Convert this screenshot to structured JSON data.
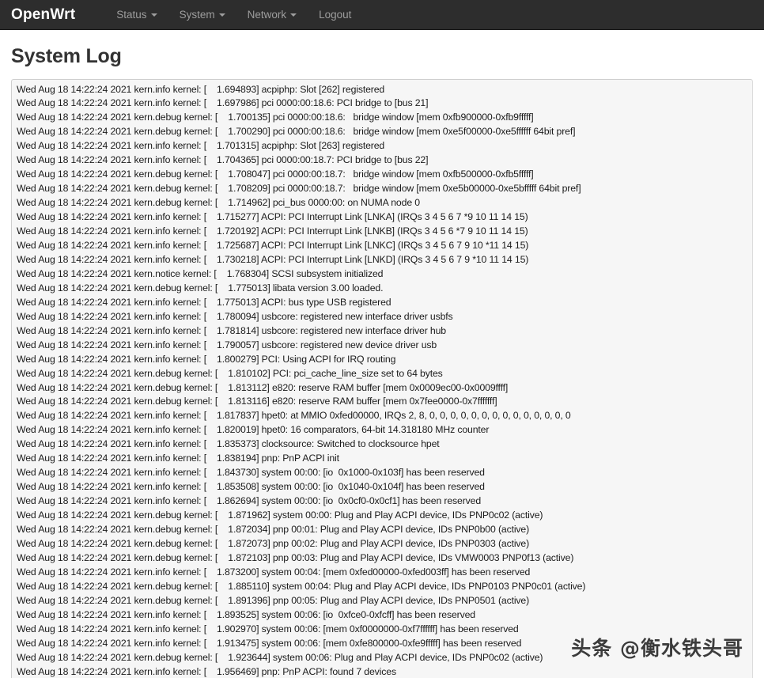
{
  "navbar": {
    "brand": "OpenWrt",
    "items": [
      {
        "label": "Status",
        "has_caret": true
      },
      {
        "label": "System",
        "has_caret": true
      },
      {
        "label": "Network",
        "has_caret": true
      },
      {
        "label": "Logout",
        "has_caret": false
      }
    ]
  },
  "page": {
    "title": "System Log"
  },
  "log": {
    "lines": [
      "Wed Aug 18 14:22:24 2021 kern.info kernel: [    1.694893] acpiphp: Slot [262] registered",
      "Wed Aug 18 14:22:24 2021 kern.info kernel: [    1.697986] pci 0000:00:18.6: PCI bridge to [bus 21]",
      "Wed Aug 18 14:22:24 2021 kern.debug kernel: [    1.700135] pci 0000:00:18.6:   bridge window [mem 0xfb900000-0xfb9fffff]",
      "Wed Aug 18 14:22:24 2021 kern.debug kernel: [    1.700290] pci 0000:00:18.6:   bridge window [mem 0xe5f00000-0xe5ffffff 64bit pref]",
      "Wed Aug 18 14:22:24 2021 kern.info kernel: [    1.701315] acpiphp: Slot [263] registered",
      "Wed Aug 18 14:22:24 2021 kern.info kernel: [    1.704365] pci 0000:00:18.7: PCI bridge to [bus 22]",
      "Wed Aug 18 14:22:24 2021 kern.debug kernel: [    1.708047] pci 0000:00:18.7:   bridge window [mem 0xfb500000-0xfb5fffff]",
      "Wed Aug 18 14:22:24 2021 kern.debug kernel: [    1.708209] pci 0000:00:18.7:   bridge window [mem 0xe5b00000-0xe5bfffff 64bit pref]",
      "Wed Aug 18 14:22:24 2021 kern.debug kernel: [    1.714962] pci_bus 0000:00: on NUMA node 0",
      "Wed Aug 18 14:22:24 2021 kern.info kernel: [    1.715277] ACPI: PCI Interrupt Link [LNKA] (IRQs 3 4 5 6 7 *9 10 11 14 15)",
      "Wed Aug 18 14:22:24 2021 kern.info kernel: [    1.720192] ACPI: PCI Interrupt Link [LNKB] (IRQs 3 4 5 6 *7 9 10 11 14 15)",
      "Wed Aug 18 14:22:24 2021 kern.info kernel: [    1.725687] ACPI: PCI Interrupt Link [LNKC] (IRQs 3 4 5 6 7 9 10 *11 14 15)",
      "Wed Aug 18 14:22:24 2021 kern.info kernel: [    1.730218] ACPI: PCI Interrupt Link [LNKD] (IRQs 3 4 5 6 7 9 *10 11 14 15)",
      "Wed Aug 18 14:22:24 2021 kern.notice kernel: [    1.768304] SCSI subsystem initialized",
      "Wed Aug 18 14:22:24 2021 kern.debug kernel: [    1.775013] libata version 3.00 loaded.",
      "Wed Aug 18 14:22:24 2021 kern.info kernel: [    1.775013] ACPI: bus type USB registered",
      "Wed Aug 18 14:22:24 2021 kern.info kernel: [    1.780094] usbcore: registered new interface driver usbfs",
      "Wed Aug 18 14:22:24 2021 kern.info kernel: [    1.781814] usbcore: registered new interface driver hub",
      "Wed Aug 18 14:22:24 2021 kern.info kernel: [    1.790057] usbcore: registered new device driver usb",
      "Wed Aug 18 14:22:24 2021 kern.info kernel: [    1.800279] PCI: Using ACPI for IRQ routing",
      "Wed Aug 18 14:22:24 2021 kern.debug kernel: [    1.810102] PCI: pci_cache_line_size set to 64 bytes",
      "Wed Aug 18 14:22:24 2021 kern.debug kernel: [    1.813112] e820: reserve RAM buffer [mem 0x0009ec00-0x0009ffff]",
      "Wed Aug 18 14:22:24 2021 kern.debug kernel: [    1.813116] e820: reserve RAM buffer [mem 0x7fee0000-0x7fffffff]",
      "Wed Aug 18 14:22:24 2021 kern.info kernel: [    1.817837] hpet0: at MMIO 0xfed00000, IRQs 2, 8, 0, 0, 0, 0, 0, 0, 0, 0, 0, 0, 0, 0, 0, 0",
      "Wed Aug 18 14:22:24 2021 kern.info kernel: [    1.820019] hpet0: 16 comparators, 64-bit 14.318180 MHz counter",
      "Wed Aug 18 14:22:24 2021 kern.info kernel: [    1.835373] clocksource: Switched to clocksource hpet",
      "Wed Aug 18 14:22:24 2021 kern.info kernel: [    1.838194] pnp: PnP ACPI init",
      "Wed Aug 18 14:22:24 2021 kern.info kernel: [    1.843730] system 00:00: [io  0x1000-0x103f] has been reserved",
      "Wed Aug 18 14:22:24 2021 kern.info kernel: [    1.853508] system 00:00: [io  0x1040-0x104f] has been reserved",
      "Wed Aug 18 14:22:24 2021 kern.info kernel: [    1.862694] system 00:00: [io  0x0cf0-0x0cf1] has been reserved",
      "Wed Aug 18 14:22:24 2021 kern.debug kernel: [    1.871962] system 00:00: Plug and Play ACPI device, IDs PNP0c02 (active)",
      "Wed Aug 18 14:22:24 2021 kern.debug kernel: [    1.872034] pnp 00:01: Plug and Play ACPI device, IDs PNP0b00 (active)",
      "Wed Aug 18 14:22:24 2021 kern.debug kernel: [    1.872073] pnp 00:02: Plug and Play ACPI device, IDs PNP0303 (active)",
      "Wed Aug 18 14:22:24 2021 kern.debug kernel: [    1.872103] pnp 00:03: Plug and Play ACPI device, IDs VMW0003 PNP0f13 (active)",
      "Wed Aug 18 14:22:24 2021 kern.info kernel: [    1.873200] system 00:04: [mem 0xfed00000-0xfed003ff] has been reserved",
      "Wed Aug 18 14:22:24 2021 kern.debug kernel: [    1.885110] system 00:04: Plug and Play ACPI device, IDs PNP0103 PNP0c01 (active)",
      "Wed Aug 18 14:22:24 2021 kern.debug kernel: [    1.891396] pnp 00:05: Plug and Play ACPI device, IDs PNP0501 (active)",
      "Wed Aug 18 14:22:24 2021 kern.info kernel: [    1.893525] system 00:06: [io  0xfce0-0xfcff] has been reserved",
      "Wed Aug 18 14:22:24 2021 kern.info kernel: [    1.902970] system 00:06: [mem 0xf0000000-0xf7ffffff] has been reserved",
      "Wed Aug 18 14:22:24 2021 kern.info kernel: [    1.913475] system 00:06: [mem 0xfe800000-0xfe9fffff] has been reserved",
      "Wed Aug 18 14:22:24 2021 kern.debug kernel: [    1.923644] system 00:06: Plug and Play ACPI device, IDs PNP0c02 (active)",
      "Wed Aug 18 14:22:24 2021 kern.info kernel: [    1.956469] pnp: PnP ACPI: found 7 devices"
    ]
  },
  "watermark": {
    "text": "头条 @衡水铁头哥"
  },
  "colors": {
    "navbar_bg": "#2d2d2d",
    "nav_text": "#9d9d9d",
    "brand_text": "#ffffff",
    "log_bg": "#f6f6f6",
    "log_text": "#1b1b1b",
    "title_text": "#333333"
  }
}
